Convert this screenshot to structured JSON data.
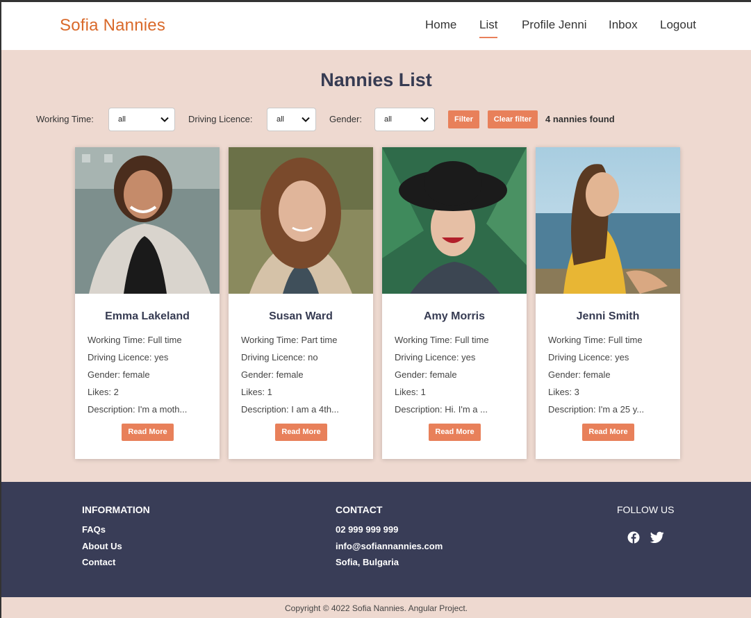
{
  "brand": "Sofia Nannies",
  "nav": [
    {
      "label": "Home",
      "active": false
    },
    {
      "label": "List",
      "active": true
    },
    {
      "label": "Profile Jenni",
      "active": false
    },
    {
      "label": "Inbox",
      "active": false
    },
    {
      "label": "Logout",
      "active": false
    }
  ],
  "page_title": "Nannies List",
  "filters": {
    "working_time": {
      "label": "Working Time:",
      "value": "all"
    },
    "driving_licence": {
      "label": "Driving Licence:",
      "value": "all"
    },
    "gender": {
      "label": "Gender:",
      "value": "all"
    },
    "filter_button": "Filter",
    "clear_button": "Clear filter",
    "results": "4 nannies found"
  },
  "accent_color": "#e8805a",
  "brand_color": "#d9692a",
  "cards": [
    {
      "name": "Emma Lakeland",
      "working_time": "Working Time: Full time",
      "driving": "Driving Licence: yes",
      "gender": "Gender: female",
      "likes": "Likes: 2",
      "description": "Description: I'm a moth...",
      "button": "Read More"
    },
    {
      "name": "Susan Ward",
      "working_time": "Working Time: Part time",
      "driving": "Driving Licence: no",
      "gender": "Gender: female",
      "likes": "Likes: 1",
      "description": "Description: I am a 4th...",
      "button": "Read More"
    },
    {
      "name": "Amy Morris",
      "working_time": "Working Time: Full time",
      "driving": "Driving Licence: yes",
      "gender": "Gender: female",
      "likes": "Likes: 1",
      "description": "Description: Hi. I'm a ...",
      "button": "Read More"
    },
    {
      "name": "Jenni Smith",
      "working_time": "Working Time: Full time",
      "driving": "Driving Licence: yes",
      "gender": "Gender: female",
      "likes": "Likes: 3",
      "description": "Description: I'm a 25 y...",
      "button": "Read More"
    }
  ],
  "footer": {
    "information": {
      "title": "INFORMATION",
      "links": [
        "FAQs",
        "About Us",
        "Contact"
      ]
    },
    "contact": {
      "title": "CONTACT",
      "lines": [
        "02 999 999 999",
        "info@sofiannannies.com",
        "Sofia, Bulgaria"
      ]
    },
    "follow": {
      "title": "FOLLOW US",
      "icons": [
        "facebook-icon",
        "twitter-icon"
      ]
    }
  },
  "copyright": "Copyright © 4022 Sofia Nannies. Angular Project."
}
